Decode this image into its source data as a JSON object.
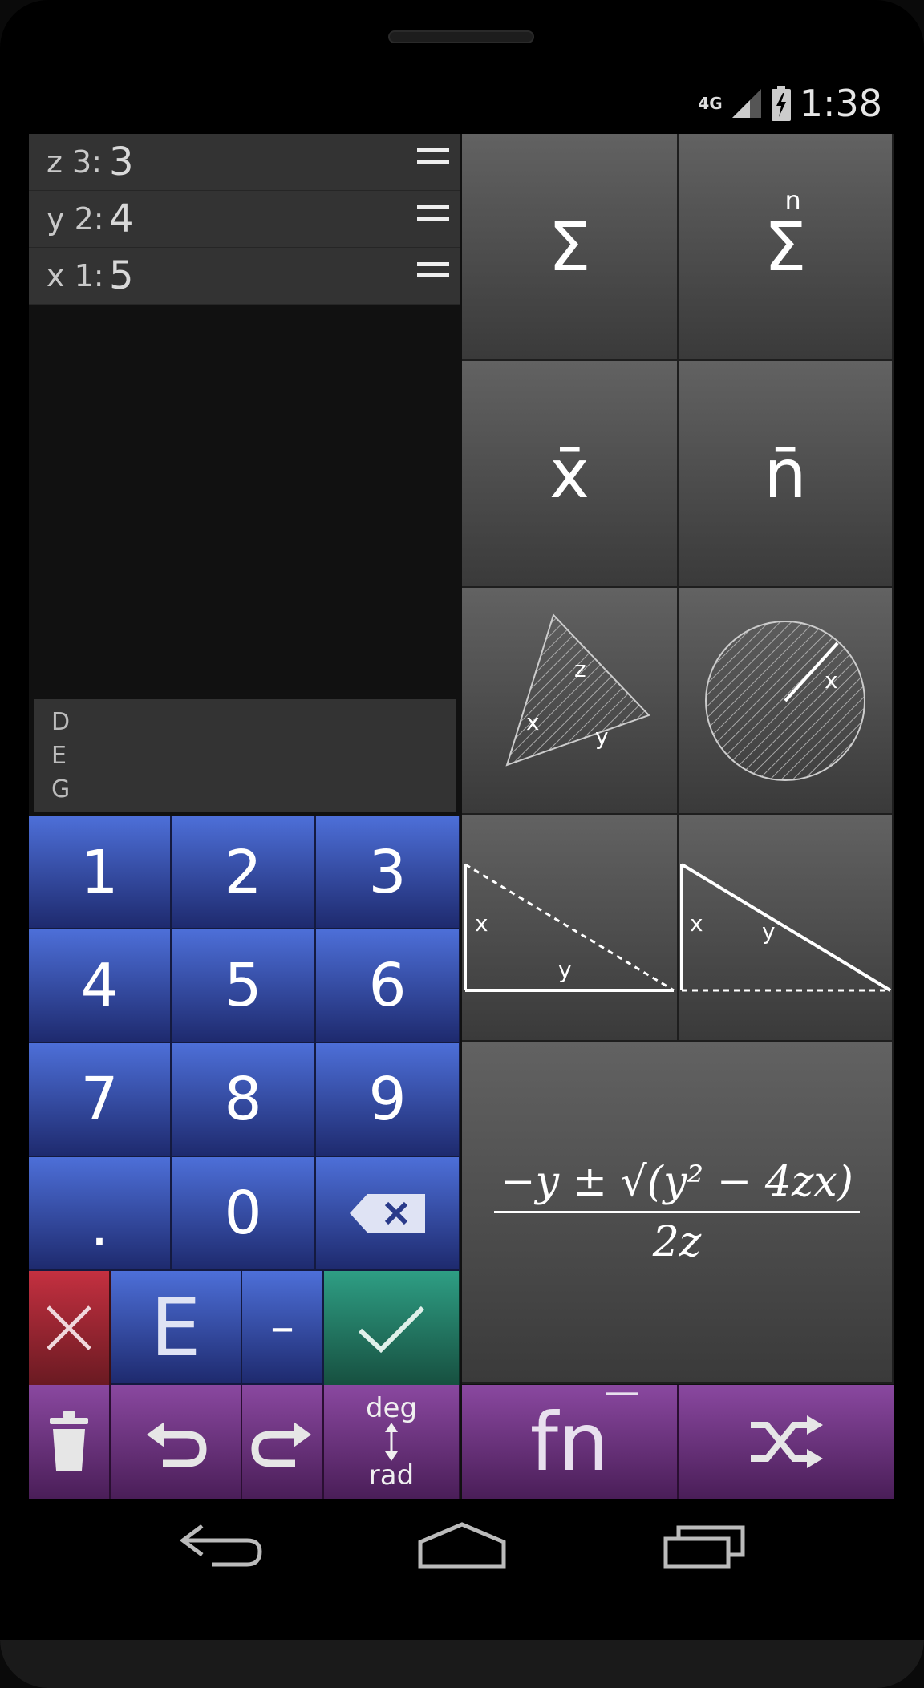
{
  "status": {
    "network": "4G",
    "time": "1:38"
  },
  "stack": [
    {
      "reg": "z",
      "idx": "3:",
      "value": "3"
    },
    {
      "reg": "y",
      "idx": "2:",
      "value": "4"
    },
    {
      "reg": "x",
      "idx": "1:",
      "value": "5"
    }
  ],
  "mode": [
    "D",
    "E",
    "G"
  ],
  "functions": {
    "sum": "Σ",
    "sum_n": "Σ",
    "sum_n_sup": "n",
    "mean_x": "x̄",
    "mean_n": "n̄",
    "triangle_labels": [
      "z",
      "x",
      "y"
    ],
    "circle_label": "x",
    "right_tri_a": [
      "x",
      "y"
    ],
    "right_tri_b": [
      "x",
      "y"
    ],
    "quadratic": {
      "num": "−y ± √(y² − 4zx)",
      "den": "2z"
    }
  },
  "keypad": {
    "keys": [
      "1",
      "2",
      "3",
      "4",
      "5",
      "6",
      "7",
      "8",
      "9",
      ".",
      "0"
    ],
    "clear": "×",
    "exp": "E",
    "neg": "–",
    "enter": "✓"
  },
  "bottom": {
    "deg": "deg",
    "rad": "rad",
    "fn": "fn",
    "fn_sup": "—"
  },
  "colors": {
    "keypad_blue": "#3d5bc4",
    "clear_red": "#b52a3a",
    "enter_teal": "#2a8f77",
    "bottom_purple": "#7a3f8e"
  }
}
